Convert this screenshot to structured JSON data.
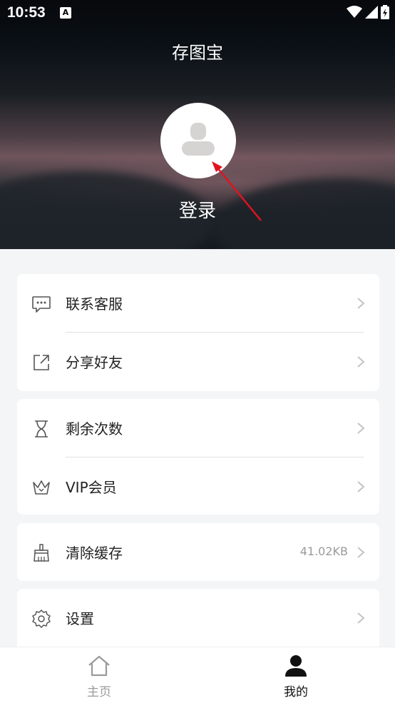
{
  "status_bar": {
    "time": "10:53",
    "notification_icon": "A"
  },
  "header": {
    "title": "存图宝",
    "login_label": "登录"
  },
  "menu_groups": [
    [
      {
        "icon": "chat-bubble-icon",
        "label": "联系客服"
      },
      {
        "icon": "share-icon",
        "label": "分享好友"
      }
    ],
    [
      {
        "icon": "hourglass-icon",
        "label": "剩余次数"
      },
      {
        "icon": "crown-icon",
        "label": "VIP会员"
      }
    ],
    [
      {
        "icon": "broom-icon",
        "label": "清除缓存",
        "value": "41.02KB"
      }
    ],
    [
      {
        "icon": "gear-icon",
        "label": "设置"
      }
    ]
  ],
  "tabbar": {
    "home": {
      "icon": "home-icon",
      "label": "主页"
    },
    "mine": {
      "icon": "person-icon",
      "label": "我的",
      "active": true
    }
  },
  "colors": {
    "active_tab": "#111111",
    "inactive_tab": "#9a9a9a",
    "annotation_arrow": "#e0141e"
  }
}
